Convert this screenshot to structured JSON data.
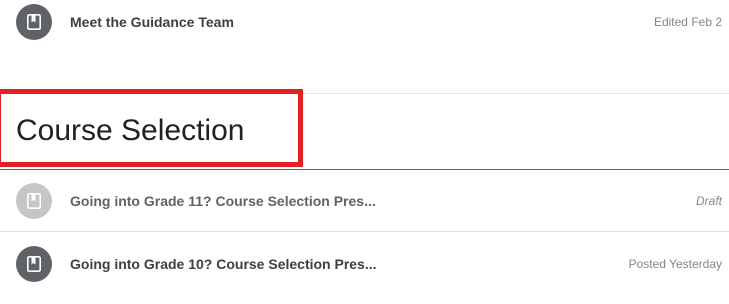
{
  "items": [
    {
      "title": "Meet the Guidance Team",
      "meta": "Edited Feb 2",
      "icon": "bookmark-icon",
      "state": "edited"
    },
    {
      "title": "Going into Grade 11? Course Selection Pres...",
      "meta": "Draft",
      "icon": "bookmark-icon",
      "state": "draft"
    },
    {
      "title": "Going into Grade 10? Course Selection Pres...",
      "meta": "Posted Yesterday",
      "icon": "bookmark-icon",
      "state": "posted"
    }
  ],
  "section": {
    "heading": "Course Selection"
  },
  "colors": {
    "icon_dark": "#5f6368",
    "icon_light": "#c6c6c6",
    "highlight": "#e32026"
  }
}
